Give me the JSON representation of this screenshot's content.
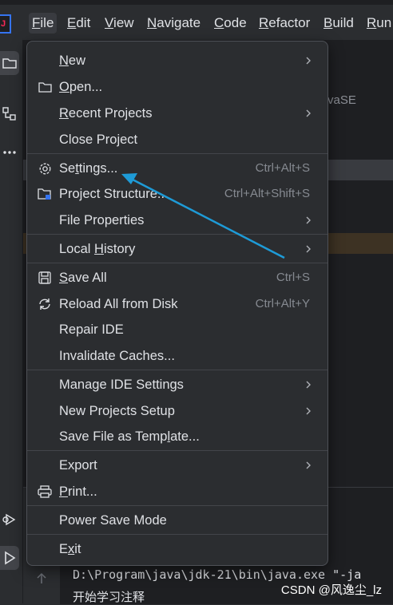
{
  "menubar": {
    "items": [
      {
        "label": "File",
        "mnemonic": "F",
        "rest": "ile"
      },
      {
        "label": "Edit",
        "mnemonic": "E",
        "rest": "dit"
      },
      {
        "label": "View",
        "mnemonic": "V",
        "rest": "iew"
      },
      {
        "label": "Navigate",
        "mnemonic": "N",
        "rest": "avigate"
      },
      {
        "label": "Code",
        "mnemonic": "C",
        "rest": "ode"
      },
      {
        "label": "Refactor",
        "mnemonic": "R",
        "rest": "efactor"
      },
      {
        "label": "Build",
        "mnemonic": "B",
        "rest": "uild"
      },
      {
        "label": "Run",
        "mnemonic": "R",
        "rest": "un"
      }
    ]
  },
  "editor": {
    "behind_fragment": "vaSE"
  },
  "file_menu": {
    "new": {
      "pre": "",
      "mn": "N",
      "post": "ew"
    },
    "open": {
      "pre": "",
      "mn": "O",
      "post": "pen..."
    },
    "recent_projects": {
      "pre": "",
      "mn": "R",
      "post": "ecent Projects"
    },
    "close_project": "Close Project",
    "settings": {
      "pre": "Se",
      "mn": "t",
      "post": "tings...",
      "shortcut": "Ctrl+Alt+S"
    },
    "project_structure": {
      "label": "Project Structure...",
      "shortcut": "Ctrl+Alt+Shift+S"
    },
    "file_properties": "File Properties",
    "local_history": {
      "pre": "Local ",
      "mn": "H",
      "post": "istory"
    },
    "save_all": {
      "pre": "",
      "mn": "S",
      "post": "ave All",
      "shortcut": "Ctrl+S"
    },
    "reload_all": {
      "label": "Reload All from Disk",
      "shortcut": "Ctrl+Alt+Y"
    },
    "repair_ide": "Repair IDE",
    "invalidate_caches": "Invalidate Caches...",
    "manage_ide_settings": "Manage IDE Settings",
    "new_projects_setup": "New Projects Setup",
    "save_as_template": {
      "pre": "Save File as Temp",
      "mn": "l",
      "post": "ate..."
    },
    "export": "Export",
    "print": {
      "pre": "",
      "mn": "P",
      "post": "rint..."
    },
    "power_save_mode": "Power Save Mode",
    "exit": {
      "pre": "E",
      "mn": "x",
      "post": "it"
    }
  },
  "console": {
    "line1": "D:\\Program\\java\\jdk-21\\bin\\java.exe \"-ja",
    "line2": "开始学习注释"
  },
  "watermark": "CSDN @风逸尘_lz",
  "colors": {
    "accent": "#3574f0",
    "arrow": "#1e9bd7",
    "menu_bg": "#2b2d30",
    "text": "#dfe1e5",
    "shortcut": "#868a91"
  }
}
